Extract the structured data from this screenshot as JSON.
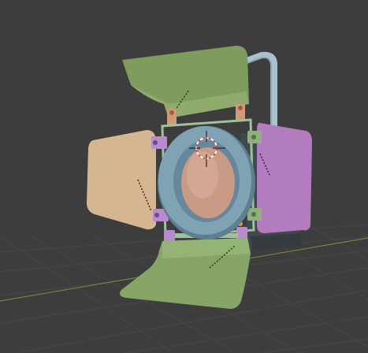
{
  "viewport": {
    "background": "#3d3d3d",
    "grid_color": "#474747",
    "x_axis_color": "#6f8a3a",
    "cursor": "3d-cursor-icon"
  },
  "model": {
    "type": "fresnel-spotlight",
    "parts": [
      {
        "name": "top-barn-door",
        "color": "#7f9c5f"
      },
      {
        "name": "bottom-barn-door",
        "color": "#86a567"
      },
      {
        "name": "left-barn-door",
        "color": "#d6b692"
      },
      {
        "name": "right-barn-door",
        "color": "#b37cbf"
      },
      {
        "name": "lens-ring",
        "color": "#7fa3b5"
      },
      {
        "name": "lens",
        "color": "#c99a86"
      },
      {
        "name": "handle",
        "color": "#a8c3cf"
      },
      {
        "name": "housing",
        "color": "#404a4e"
      },
      {
        "name": "frame",
        "color": "#9fc19a"
      },
      {
        "name": "top-hinges",
        "color": "#cf9a78"
      },
      {
        "name": "left-hinges",
        "color": "#b88bd0"
      },
      {
        "name": "right-hinges",
        "color": "#8fb07a"
      },
      {
        "name": "status-dot",
        "color": "#d89a35"
      }
    ]
  }
}
